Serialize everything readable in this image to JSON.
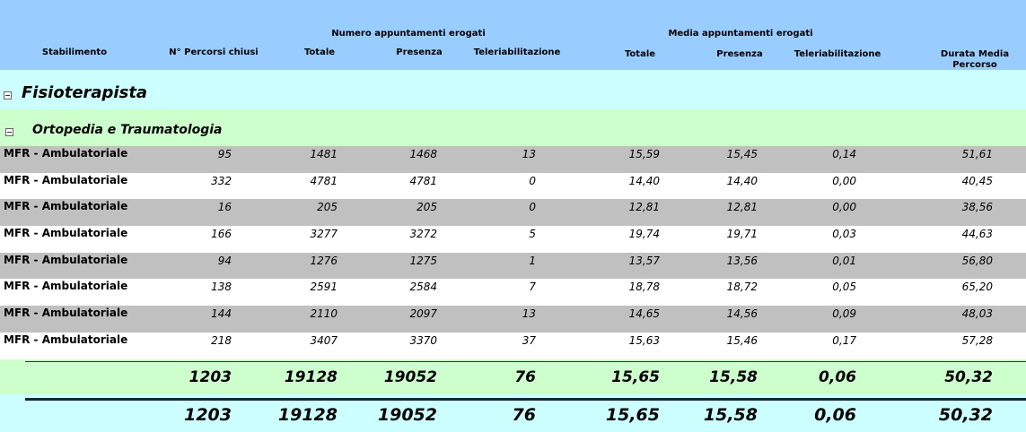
{
  "header": {
    "group_numero": "Numero appuntamenti erogati",
    "group_media": "Media appuntamenti erogati",
    "columns": {
      "stabilimento": "Stabilimento",
      "percorsi": "N° Percorsi chiusi",
      "totale": "Totale",
      "presenza": "Presenza",
      "teleriab": "Teleriabilitazione",
      "m_totale": "Totale",
      "m_presenza": "Presenza",
      "m_teleriab": "Teleriabilitazione",
      "durata_line1": "Durata Media",
      "durata_line2": "Percorso"
    }
  },
  "groups": {
    "level1": "Fisioterapista",
    "level2": "Ortopedia e Traumatologia"
  },
  "rows": [
    {
      "name": "MFR - Ambulatoriale",
      "percorsi": "95",
      "totale": "1481",
      "presenza": "1468",
      "teleriab": "13",
      "m_totale": "15,59",
      "m_presenza": "15,45",
      "m_teleriab": "0,14",
      "durata": "51,61"
    },
    {
      "name": "MFR - Ambulatoriale",
      "percorsi": "332",
      "totale": "4781",
      "presenza": "4781",
      "teleriab": "0",
      "m_totale": "14,40",
      "m_presenza": "14,40",
      "m_teleriab": "0,00",
      "durata": "40,45"
    },
    {
      "name": "MFR - Ambulatoriale",
      "percorsi": "16",
      "totale": "205",
      "presenza": "205",
      "teleriab": "0",
      "m_totale": "12,81",
      "m_presenza": "12,81",
      "m_teleriab": "0,00",
      "durata": "38,56"
    },
    {
      "name": "MFR - Ambulatoriale",
      "percorsi": "166",
      "totale": "3277",
      "presenza": "3272",
      "teleriab": "5",
      "m_totale": "19,74",
      "m_presenza": "19,71",
      "m_teleriab": "0,03",
      "durata": "44,63"
    },
    {
      "name": "MFR - Ambulatoriale",
      "percorsi": "94",
      "totale": "1276",
      "presenza": "1275",
      "teleriab": "1",
      "m_totale": "13,57",
      "m_presenza": "13,56",
      "m_teleriab": "0,01",
      "durata": "56,80"
    },
    {
      "name": "MFR - Ambulatoriale",
      "percorsi": "138",
      "totale": "2591",
      "presenza": "2584",
      "teleriab": "7",
      "m_totale": "18,78",
      "m_presenza": "18,72",
      "m_teleriab": "0,05",
      "durata": "65,20"
    },
    {
      "name": "MFR - Ambulatoriale",
      "percorsi": "144",
      "totale": "2110",
      "presenza": "2097",
      "teleriab": "13",
      "m_totale": "14,65",
      "m_presenza": "14,56",
      "m_teleriab": "0,09",
      "durata": "48,03"
    },
    {
      "name": "MFR - Ambulatoriale",
      "percorsi": "218",
      "totale": "3407",
      "presenza": "3370",
      "teleriab": "37",
      "m_totale": "15,63",
      "m_presenza": "15,46",
      "m_teleriab": "0,17",
      "durata": "57,28"
    }
  ],
  "subtotal": {
    "percorsi": "1203",
    "totale": "19128",
    "presenza": "19052",
    "teleriab": "76",
    "m_totale": "15,65",
    "m_presenza": "15,58",
    "m_teleriab": "0,06",
    "durata": "50,32"
  },
  "total": {
    "percorsi": "1203",
    "totale": "19128",
    "presenza": "19052",
    "teleriab": "76",
    "m_totale": "15,65",
    "m_presenza": "15,58",
    "m_teleriab": "0,06",
    "durata": "50,32"
  },
  "colors": {
    "header_bg": "#99ccff",
    "group1_bg": "#ccffff",
    "group2_bg": "#ccffcc",
    "row_gray": "#c0c0c0",
    "row_white": "#ffffff"
  }
}
